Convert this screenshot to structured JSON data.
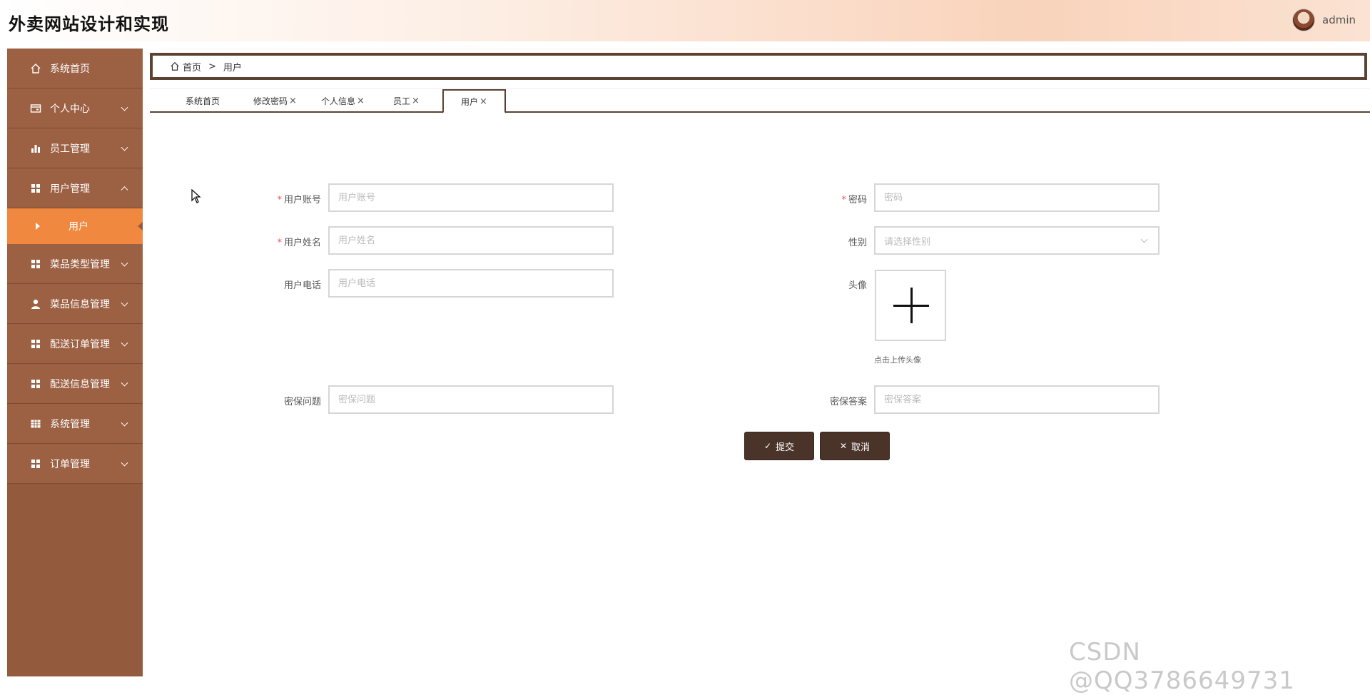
{
  "app": {
    "title": "外卖网站设计和实现"
  },
  "user": {
    "name": "admin"
  },
  "sidebar": {
    "items": [
      {
        "label": "系统首页",
        "icon": "home-icon"
      },
      {
        "label": "个人中心",
        "icon": "wallet-icon"
      },
      {
        "label": "员工管理",
        "icon": "bar-chart-icon"
      },
      {
        "label": "用户管理",
        "icon": "grid-icon",
        "expanded": true
      },
      {
        "label": "菜品类型管理",
        "icon": "grid-icon"
      },
      {
        "label": "菜品信息管理",
        "icon": "person-icon"
      },
      {
        "label": "配送订单管理",
        "icon": "grid-icon"
      },
      {
        "label": "配送信息管理",
        "icon": "grid-icon"
      },
      {
        "label": "系统管理",
        "icon": "table-icon"
      },
      {
        "label": "订单管理",
        "icon": "grid-icon"
      }
    ],
    "sub_item": {
      "label": "用户"
    }
  },
  "breadcrumb": {
    "home": "首页",
    "separator": ">",
    "current": "用户"
  },
  "tabs": [
    {
      "label": "系统首页",
      "closable": false
    },
    {
      "label": "修改密码",
      "closable": true
    },
    {
      "label": "个人信息",
      "closable": true
    },
    {
      "label": "员工",
      "closable": true
    },
    {
      "label": "用户",
      "closable": true,
      "active": true
    }
  ],
  "tab_close": "×",
  "form": {
    "account": {
      "label": "用户账号",
      "placeholder": "用户账号",
      "required": "*"
    },
    "password": {
      "label": "密码",
      "placeholder": "密码",
      "required": "*"
    },
    "name": {
      "label": "用户姓名",
      "placeholder": "用户姓名",
      "required": "*"
    },
    "gender": {
      "label": "性别",
      "placeholder": "请选择性别"
    },
    "phone": {
      "label": "用户电话",
      "placeholder": "用户电话"
    },
    "avatar": {
      "label": "头像",
      "hint": "点击上传头像"
    },
    "question": {
      "label": "密保问题",
      "placeholder": "密保问题"
    },
    "answer": {
      "label": "密保答案",
      "placeholder": "密保答案"
    }
  },
  "buttons": {
    "submit": "提交",
    "cancel": "取消"
  },
  "watermark": "CSDN @QQ3786649731",
  "colors": {
    "sidebar": "#945a3d",
    "sidebar_active": "#f08840",
    "accent_dark": "#4a3329"
  }
}
